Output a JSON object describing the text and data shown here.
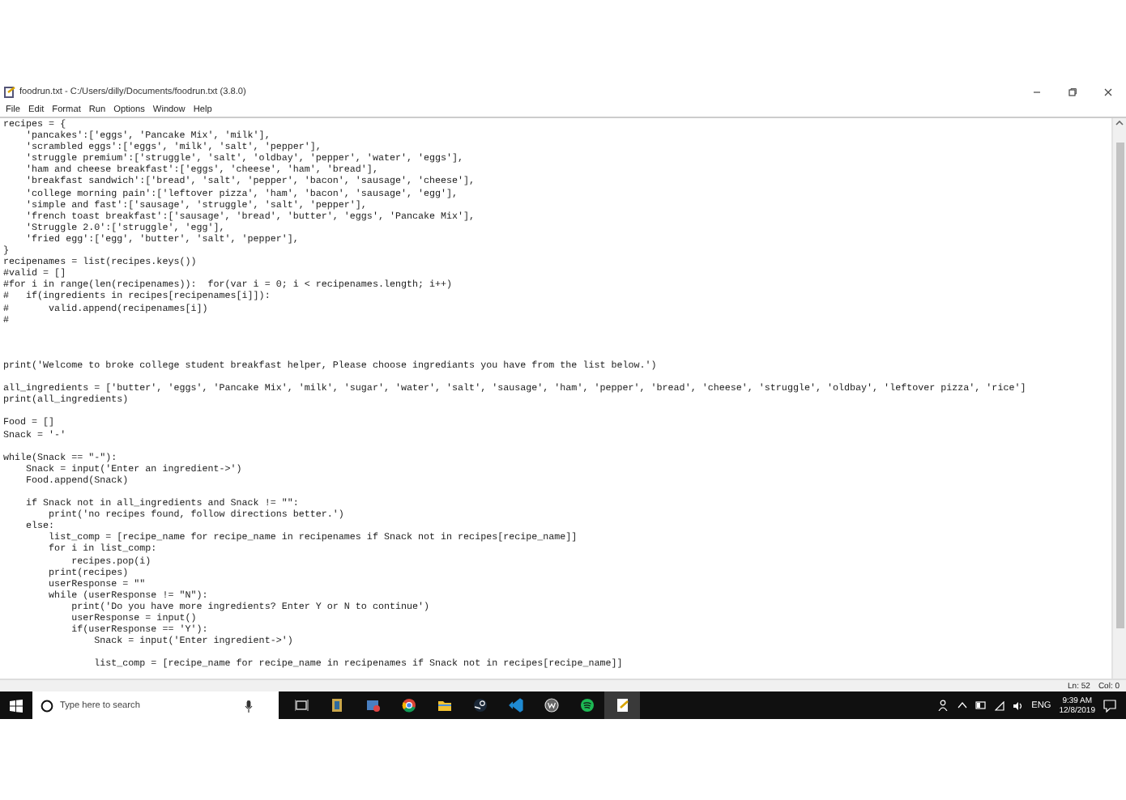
{
  "window": {
    "title": "foodrun.txt - C:/Users/dilly/Documents/foodrun.txt (3.8.0)"
  },
  "menu": [
    "File",
    "Edit",
    "Format",
    "Run",
    "Options",
    "Window",
    "Help"
  ],
  "code_lines": [
    {
      "kind": "code",
      "text": "recipes = {"
    },
    {
      "kind": "code",
      "text": "    'pancakes':['eggs', 'Pancake Mix', 'milk'],"
    },
    {
      "kind": "code",
      "text": "    'scrambled eggs':['eggs', 'milk', 'salt', 'pepper'],"
    },
    {
      "kind": "code",
      "text": "    'struggle premium':['struggle', 'salt', 'oldbay', 'pepper', 'water', 'eggs'],"
    },
    {
      "kind": "code",
      "text": "    'ham and cheese breakfast':['eggs', 'cheese', 'ham', 'bread'],"
    },
    {
      "kind": "code",
      "text": "    'breakfast sandwich':['bread', 'salt', 'pepper', 'bacon', 'sausage', 'cheese'],"
    },
    {
      "kind": "code",
      "text": "    'college morning pain':['leftover pizza', 'ham', 'bacon', 'sausage', 'egg'],"
    },
    {
      "kind": "code",
      "text": "    'simple and fast':['sausage', 'struggle', 'salt', 'pepper'],"
    },
    {
      "kind": "code",
      "text": "    'french toast breakfast':['sausage', 'bread', 'butter', 'eggs', 'Pancake Mix'],"
    },
    {
      "kind": "code",
      "text": "    'Struggle 2.0':['struggle', 'egg'],"
    },
    {
      "kind": "code",
      "text": "    'fried egg':['egg', 'butter', 'salt', 'pepper'],"
    },
    {
      "kind": "code",
      "text": "}"
    },
    {
      "kind": "code",
      "text": "recipenames = list(recipes.keys())"
    },
    {
      "kind": "code",
      "text": "#valid = []"
    },
    {
      "kind": "code",
      "text": "#for i in range(len(recipenames)):  for(var i = 0; i < recipenames.length; i++)"
    },
    {
      "kind": "code",
      "text": "#   if(ingredients in recipes[recipenames[i]]):"
    },
    {
      "kind": "code",
      "text": "#       valid.append(recipenames[i])"
    },
    {
      "kind": "code",
      "text": "#"
    },
    {
      "kind": "blank"
    },
    {
      "kind": "blank"
    },
    {
      "kind": "blank"
    },
    {
      "kind": "code",
      "text": "print('Welcome to broke college student breakfast helper, Please choose ingrediants you have from the list below.')"
    },
    {
      "kind": "blank"
    },
    {
      "kind": "code",
      "text": "all_ingredients = ['butter', 'eggs', 'Pancake Mix', 'milk', 'sugar', 'water', 'salt', 'sausage', 'ham', 'pepper', 'bread', 'cheese', 'struggle', 'oldbay', 'leftover pizza', 'rice']"
    },
    {
      "kind": "code",
      "text": "print(all_ingredients)"
    },
    {
      "kind": "blank"
    },
    {
      "kind": "code",
      "text": "Food = []"
    },
    {
      "kind": "code",
      "text": "Snack = '-'"
    },
    {
      "kind": "blank"
    },
    {
      "kind": "code",
      "text": "while(Snack == \"-\"):"
    },
    {
      "kind": "code",
      "text": "    Snack = input('Enter an ingredient->')"
    },
    {
      "kind": "code",
      "text": "    Food.append(Snack)"
    },
    {
      "kind": "blank"
    },
    {
      "kind": "code",
      "text": "    if Snack not in all_ingredients and Snack != \"\":"
    },
    {
      "kind": "code",
      "text": "        print('no recipes found, follow directions better.')"
    },
    {
      "kind": "code",
      "text": "    else:"
    },
    {
      "kind": "code",
      "text": "        list_comp = [recipe_name for recipe_name in recipenames if Snack not in recipes[recipe_name]]"
    },
    {
      "kind": "code",
      "text": "        for i in list_comp:"
    },
    {
      "kind": "code",
      "text": "            recipes.pop(i)"
    },
    {
      "kind": "code",
      "text": "        print(recipes)"
    },
    {
      "kind": "code",
      "text": "        userResponse = \"\""
    },
    {
      "kind": "code",
      "text": "        while (userResponse != \"N\"):"
    },
    {
      "kind": "code",
      "text": "            print('Do you have more ingredients? Enter Y or N to continue')"
    },
    {
      "kind": "code",
      "text": "            userResponse = input()"
    },
    {
      "kind": "code",
      "text": "            if(userResponse == 'Y'):"
    },
    {
      "kind": "code",
      "text": "                Snack = input('Enter ingredient->')"
    },
    {
      "kind": "blank"
    },
    {
      "kind": "code",
      "text": "                list_comp = [recipe_name for recipe_name in recipenames if Snack not in recipes[recipe_name]]"
    }
  ],
  "status_bar": {
    "line": "Ln: 52",
    "column": "Col: 0"
  },
  "taskbar": {
    "search": {
      "placeholder": "Type here to search"
    },
    "language": "ENG",
    "time": "9:39 AM",
    "date": "12/8/2019"
  }
}
